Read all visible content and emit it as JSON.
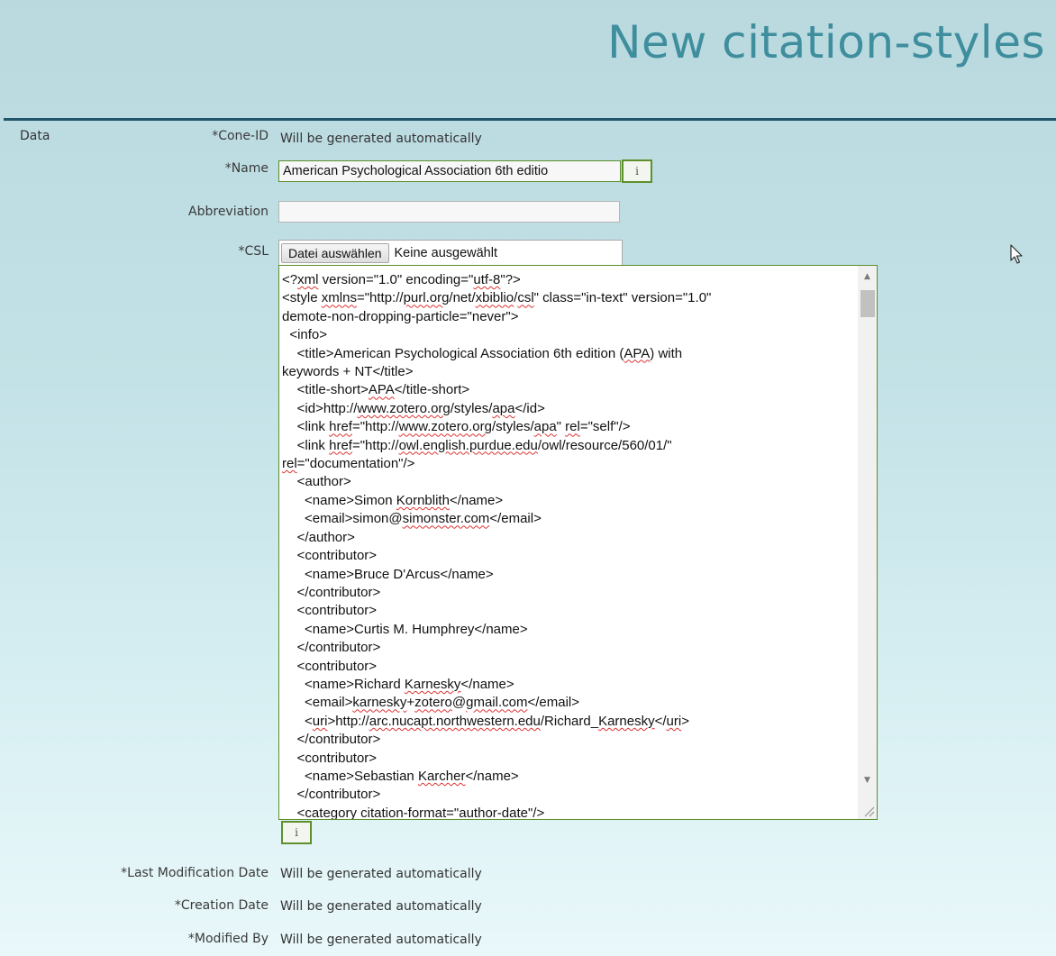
{
  "page": {
    "title": "New citation-styles"
  },
  "section": {
    "tab": "Data"
  },
  "fields": {
    "cone_id": {
      "label": "*Cone-ID",
      "value": "Will be generated automatically"
    },
    "name": {
      "label": "*Name",
      "value": "American Psychological Association 6th editio",
      "info": "i"
    },
    "abbreviation": {
      "label": "Abbreviation",
      "value": ""
    },
    "csl": {
      "label": "*CSL",
      "file_button": "Datei auswählen",
      "file_status": "Keine ausgewählt",
      "info": "i",
      "lines": [
        "<?xml version=\"1.0\" encoding=\"utf-8\"?>",
        "<style xmlns=\"http://purl.org/net/xbiblio/csl\" class=\"in-text\" version=\"1.0\"",
        "demote-non-dropping-particle=\"never\">",
        "  <info>",
        "    <title>American Psychological Association 6th edition (APA) with",
        "keywords + NT</title>",
        "    <title-short>APA</title-short>",
        "    <id>http://www.zotero.org/styles/apa</id>",
        "    <link href=\"http://www.zotero.org/styles/apa\" rel=\"self\"/>",
        "    <link href=\"http://owl.english.purdue.edu/owl/resource/560/01/\"",
        "rel=\"documentation\"/>",
        "    <author>",
        "      <name>Simon Kornblith</name>",
        "      <email>simon@simonster.com</email>",
        "    </author>",
        "    <contributor>",
        "      <name>Bruce D'Arcus</name>",
        "    </contributor>",
        "    <contributor>",
        "      <name>Curtis M. Humphrey</name>",
        "    </contributor>",
        "    <contributor>",
        "      <name>Richard Karnesky</name>",
        "      <email>karnesky+zotero@gmail.com</email>",
        "      <uri>http://arc.nucapt.northwestern.edu/Richard_Karnesky</uri>",
        "    </contributor>",
        "    <contributor>",
        "      <name>Sebastian Karcher</name>",
        "    </contributor>",
        "    <category citation-format=\"author-date\"/>"
      ],
      "underlined": [
        [
          "xml",
          "utf-8"
        ],
        [
          "xmlns",
          "purl.org",
          "xbiblio",
          "csl"
        ],
        [],
        [],
        [
          "APA"
        ],
        [],
        [
          "APA"
        ],
        [
          "www.zotero.org",
          "apa"
        ],
        [
          "href",
          "www.zotero.org",
          "apa",
          "rel"
        ],
        [
          "href",
          "owl.english.purdue.edu"
        ],
        [
          "rel"
        ],
        [],
        [
          "Kornblith"
        ],
        [
          "simonster.com"
        ],
        [],
        [],
        [],
        [],
        [],
        [],
        [],
        [],
        [
          "Karnesky"
        ],
        [
          "karnesky",
          "zotero",
          "gmail.com"
        ],
        [
          "uri",
          "arc.nucapt.northwestern.edu",
          "Karnesky",
          "uri"
        ],
        [],
        [],
        [
          "Karcher"
        ],
        [],
        []
      ]
    },
    "last_modification_date": {
      "label": "*Last Modification Date",
      "value": "Will be generated automatically"
    },
    "creation_date": {
      "label": "*Creation Date",
      "value": "Will be generated automatically"
    },
    "modified_by": {
      "label": "*Modified By",
      "value": "Will be generated automatically"
    }
  },
  "colors": {
    "title": "#3f8e9e",
    "rule": "#21566a",
    "accent_border": "#5b8f2a",
    "background_top": "#b9d9df",
    "background_bottom": "#e9f8fa"
  }
}
